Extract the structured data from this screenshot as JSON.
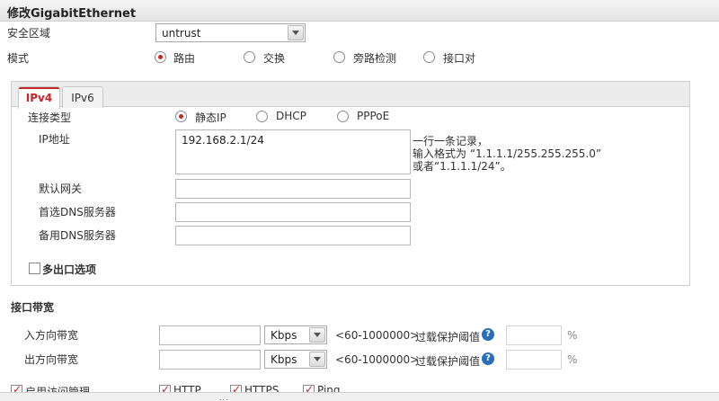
{
  "window": {
    "title": "修改GigabitEthernet"
  },
  "zone": {
    "label": "安全区域",
    "value": "untrust"
  },
  "mode": {
    "label": "模式",
    "options": [
      {
        "label": "路由",
        "selected": true
      },
      {
        "label": "交换",
        "selected": false
      },
      {
        "label": "旁路检测",
        "selected": false
      },
      {
        "label": "接口对",
        "selected": false
      }
    ]
  },
  "tabs": [
    {
      "label": "IPv4",
      "active": true
    },
    {
      "label": "IPv6",
      "active": false
    }
  ],
  "ipv4": {
    "conn_type": {
      "label": "连接类型",
      "options": [
        {
          "label": "静态IP",
          "selected": true
        },
        {
          "label": "DHCP",
          "selected": false
        },
        {
          "label": "PPPoE",
          "selected": false
        }
      ]
    },
    "ip": {
      "label": "IP地址",
      "value": "192.168.2.1/24",
      "hint": [
        "一行一条记录，",
        "输入格式为 “1.1.1.1/255.255.255.0”",
        "或者“1.1.1.1/24”。"
      ]
    },
    "gateway": {
      "label": "默认网关",
      "value": ""
    },
    "dns1": {
      "label": "首选DNS服务器",
      "value": ""
    },
    "dns2": {
      "label": "备用DNS服务器",
      "value": ""
    },
    "multi_exit": {
      "label": "多出口选项",
      "checked": false
    }
  },
  "bandwidth": {
    "section_title": "接口带宽",
    "inbound": {
      "label": "入方向带宽",
      "value": "",
      "unit": "Kbps",
      "range": "<60-1000000>",
      "threshold_label": "过载保护阈值",
      "threshold_value": "",
      "percent": "%"
    },
    "outbound": {
      "label": "出方向带宽",
      "value": "",
      "unit": "Kbps",
      "range": "<60-1000000>",
      "threshold_label": "过载保护阈值",
      "threshold_value": "",
      "percent": "%"
    }
  },
  "access": {
    "label": "启用访问管理",
    "checked": true,
    "options": [
      {
        "label": "HTTP",
        "checked": true
      },
      {
        "label": "HTTPS",
        "checked": true
      },
      {
        "label": "Ping",
        "checked": true
      }
    ]
  },
  "resize_grip": "..."
}
